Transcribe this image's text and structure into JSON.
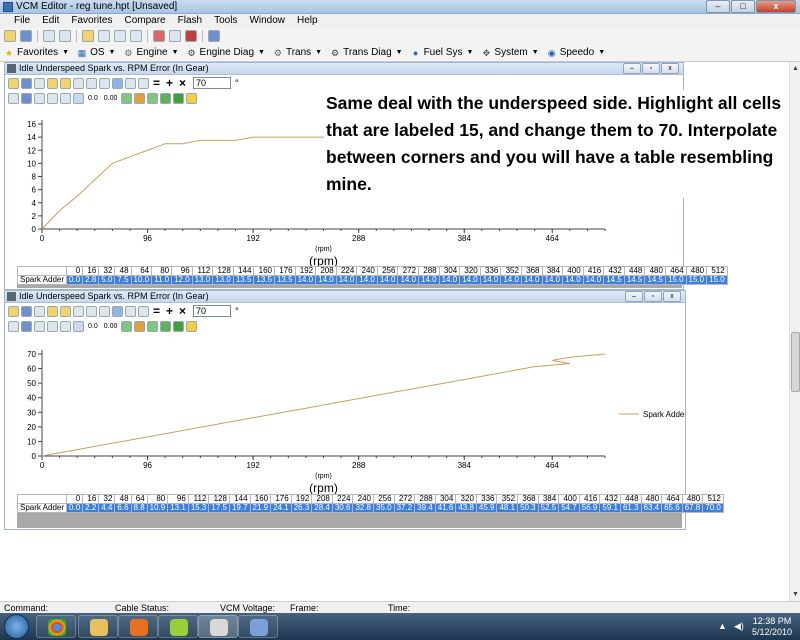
{
  "window": {
    "title": "VCM Editor - reg tune.hpt   [Unsaved]"
  },
  "menu": [
    "File",
    "Edit",
    "Favorites",
    "Compare",
    "Flash",
    "Tools",
    "Window",
    "Help"
  ],
  "toolbar2": [
    {
      "label": "Favorites",
      "icon": "star-icon",
      "color": "#e8b400"
    },
    {
      "label": "OS",
      "icon": "chip-icon",
      "color": "#2a6ab8"
    },
    {
      "label": "Engine",
      "icon": "engine-icon",
      "color": "#666666"
    },
    {
      "label": "Engine Diag",
      "icon": "engine-diag-icon",
      "color": "#444444"
    },
    {
      "label": "Trans",
      "icon": "gears-icon",
      "color": "#666666"
    },
    {
      "label": "Trans Diag",
      "icon": "trans-diag-icon",
      "color": "#444444"
    },
    {
      "label": "Fuel Sys",
      "icon": "fuel-drop-icon",
      "color": "#2a6ab8"
    },
    {
      "label": "System",
      "icon": "system-icon",
      "color": "#555555"
    },
    {
      "label": "Speedo",
      "icon": "speedo-icon",
      "color": "#2060c0"
    }
  ],
  "subwindows": [
    {
      "title": "Idle Underspeed Spark vs. RPM Error (In Gear)",
      "input_value": "70",
      "input_suffix": "°",
      "num_labels": [
        "0.0",
        "0.00"
      ]
    },
    {
      "title": "Idle Underspeed Spark vs. RPM Error (In Gear)",
      "input_value": "70",
      "input_suffix": "°",
      "num_labels": [
        "0.0",
        "0.00"
      ]
    }
  ],
  "chart_data": [
    {
      "type": "line",
      "title": "",
      "xlabel": "(rpm)",
      "ylabel": "",
      "xlim": [
        0,
        512
      ],
      "ylim": [
        0,
        16
      ],
      "xticks": [
        0,
        96,
        192,
        288,
        384,
        464
      ],
      "yticks": [
        0,
        2,
        4,
        6,
        8,
        10,
        12,
        14,
        16
      ],
      "x": [
        0,
        16,
        32,
        48,
        64,
        80,
        96,
        112,
        128,
        144,
        160,
        176,
        192,
        208,
        224,
        240,
        256,
        272,
        288,
        304,
        320,
        336,
        352,
        368,
        384,
        400,
        416,
        432,
        448,
        480,
        464,
        480,
        512
      ],
      "series": [
        {
          "label": "Spark Adder",
          "values": [
            "0.0",
            "2.8",
            "5.0",
            "7.5",
            "10.0",
            "11.0",
            "12.0",
            "13.0",
            "13.0",
            "13.5",
            "13.5",
            "13.5",
            "14.0",
            "14.0",
            "14.0",
            "14.0",
            "14.0",
            "14.0",
            "14.0",
            "14.0",
            "14.0",
            "14.0",
            "14.0",
            "14.0",
            "14.0",
            "14.0",
            "14.0",
            "14.5",
            "14.5",
            "14.5",
            "15.0",
            "15.0",
            "15.0"
          ]
        }
      ],
      "row_header": "Spark Adder",
      "legend": false
    },
    {
      "type": "line",
      "title": "",
      "xlabel": "(rpm)",
      "ylabel": "",
      "xlim": [
        0,
        512
      ],
      "ylim": [
        0,
        70
      ],
      "xticks": [
        0,
        96,
        192,
        288,
        384,
        464
      ],
      "yticks": [
        0,
        10,
        20,
        30,
        40,
        50,
        60,
        70
      ],
      "x": [
        0,
        16,
        32,
        48,
        64,
        80,
        96,
        112,
        128,
        144,
        160,
        176,
        192,
        208,
        224,
        240,
        256,
        272,
        288,
        304,
        320,
        336,
        352,
        368,
        384,
        400,
        416,
        432,
        448,
        480,
        464,
        480,
        512
      ],
      "series": [
        {
          "name": "Spark Adder",
          "values": [
            "0.0",
            "2.2",
            "4.4",
            "6.6",
            "8.8",
            "10.9",
            "13.1",
            "15.3",
            "17.5",
            "19.7",
            "21.9",
            "24.1",
            "26.3",
            "28.4",
            "30.6",
            "32.8",
            "35.0",
            "37.2",
            "39.4",
            "41.6",
            "43.8",
            "45.9",
            "48.1",
            "50.3",
            "52.5",
            "54.7",
            "56.9",
            "59.1",
            "61.3",
            "63.4",
            "65.6",
            "67.8",
            "70.0"
          ]
        }
      ],
      "row_header": "Spark Adder",
      "legend": true,
      "legend_position": "right"
    }
  ],
  "annotation": "Same deal with the underspeed side. Highlight all cells that are labeled 15, and change them to 70. Interpolate between corners and you will have a table resembling mine.",
  "status": {
    "command": "Command:",
    "cable": "Cable Status:",
    "vcm": "VCM Voltage:",
    "frame": "Frame:",
    "time": "Time:"
  },
  "taskbar": {
    "time": "12:38 PM",
    "date": "5/12/2010"
  },
  "colors": {
    "line": "#c8a060",
    "highlight": "#3d7fe0"
  }
}
